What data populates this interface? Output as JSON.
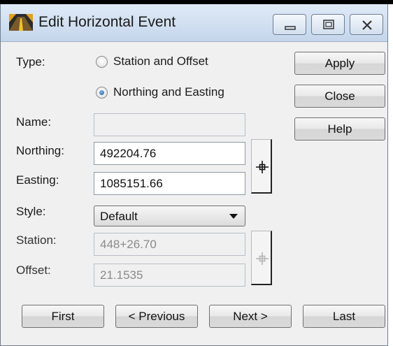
{
  "window": {
    "title": "Edit Horizontal Event",
    "app_icon": "road-app-icon",
    "controls": [
      "minimize-icon",
      "maximize-icon",
      "close-icon"
    ]
  },
  "form": {
    "type_label": "Type:",
    "type_options": [
      {
        "label": "Station and Offset",
        "selected": false
      },
      {
        "label": "Northing and Easting",
        "selected": true
      }
    ],
    "name_label": "Name:",
    "name_value": "",
    "northing_label": "Northing:",
    "northing_value": "492204.76",
    "easting_label": "Easting:",
    "easting_value": "1085151.66",
    "style_label": "Style:",
    "style_value": "Default",
    "station_label": "Station:",
    "station_value": "448+26.70",
    "offset_label": "Offset:",
    "offset_value": "21.1535"
  },
  "side_buttons": {
    "apply": "Apply",
    "close": "Close",
    "help": "Help"
  },
  "nav_buttons": {
    "first": "First",
    "previous": "< Previous",
    "next": "Next >",
    "last": "Last"
  },
  "colors": {
    "titlebar": "#c5d6eb",
    "dialog_bg": "#f0f0f0",
    "radio_selected": "#1b5fa8"
  }
}
